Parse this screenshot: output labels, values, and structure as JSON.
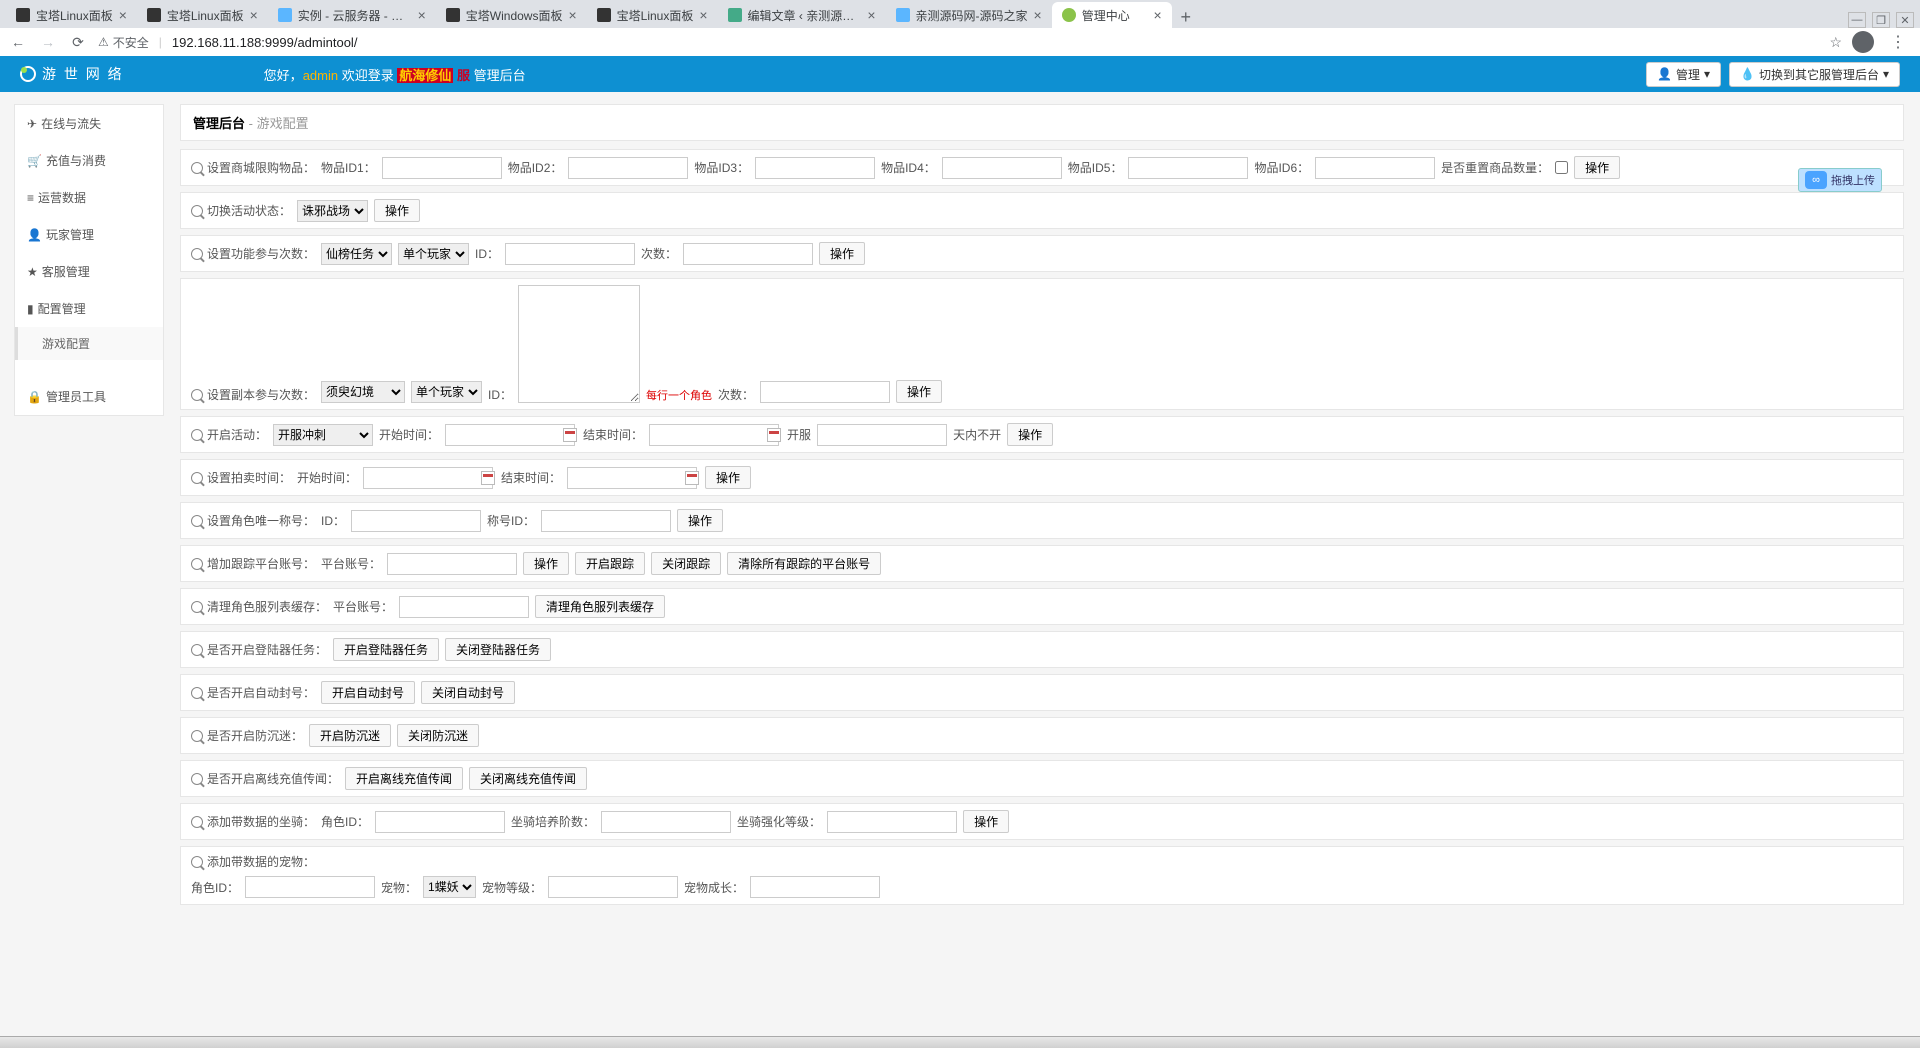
{
  "browser": {
    "tabs": [
      {
        "title": "宝塔Linux面板",
        "fav": "#333"
      },
      {
        "title": "宝塔Linux面板",
        "fav": "#333"
      },
      {
        "title": "实例 - 云服务器 - 控制台",
        "fav": "#5bb6ff"
      },
      {
        "title": "宝塔Windows面板",
        "fav": "#333"
      },
      {
        "title": "宝塔Linux面板",
        "fav": "#333"
      },
      {
        "title": "编辑文章 ‹ 亲测源码网 — W…",
        "fav": "#4a8"
      },
      {
        "title": "亲测源码网-源码之家",
        "fav": "#5bb6ff"
      },
      {
        "title": "管理中心",
        "fav": "#8bc34a"
      }
    ],
    "insecure": "不安全",
    "url": "192.168.11.188:9999/admintool/"
  },
  "top": {
    "brand": "游 世 网 络",
    "hello": "您好，",
    "admin": "admin",
    "welcome": " 欢迎登录 ",
    "srv1": "航海修仙",
    "srv2": "服",
    "suffix": " 管理后台",
    "btn_manage": "管理",
    "btn_switch": "切换到其它服管理后台"
  },
  "sidebar": {
    "items": [
      "在线与流失",
      "充值与消费",
      "运营数据",
      "玩家管理",
      "客服管理",
      "配置管理"
    ],
    "sub": "游戏配置",
    "last": "管理员工具"
  },
  "header": {
    "title": "管理后台",
    "sub": " - 游戏配置"
  },
  "ops": {
    "action": "操作",
    "shop": {
      "label": "设置商城限购物品：",
      "id1": "物品ID1：",
      "id2": "物品ID2：",
      "id3": "物品ID3：",
      "id4": "物品ID4：",
      "id5": "物品ID5：",
      "id6": "物品ID6：",
      "reset": "是否重置商品数量："
    },
    "activity": {
      "label": "切换活动状态：",
      "opt": "诛邪战场"
    },
    "func": {
      "label": "设置功能参与次数：",
      "o1": "仙榜任务",
      "o2": "单个玩家",
      "id": "ID：",
      "cnt": "次数："
    },
    "copy": {
      "label": "设置副本参与次数：",
      "o1": "须臾幻境",
      "o2": "单个玩家",
      "id": "ID：",
      "note": "每行一个角色",
      "cnt": "次数："
    },
    "start": {
      "label": "开启活动：",
      "opt": "开服冲刺",
      "st": "开始时间：",
      "et": "结束时间：",
      "ks": "开服",
      "dn": "天内不开"
    },
    "auction": {
      "label": "设置拍卖时间：",
      "st": "开始时间：",
      "et": "结束时间："
    },
    "unique": {
      "label": "设置角色唯一称号：",
      "id": "ID：",
      "title": "称号ID："
    },
    "track": {
      "label": "增加跟踪平台账号：",
      "acc": "平台账号：",
      "b1": "操作",
      "b2": "开启跟踪",
      "b3": "关闭跟踪",
      "b4": "清除所有跟踪的平台账号"
    },
    "cache": {
      "label": "清理角色服列表缓存：",
      "acc": "平台账号：",
      "b": "清理角色服列表缓存"
    },
    "logintask": {
      "label": "是否开启登陆器任务：",
      "b1": "开启登陆器任务",
      "b2": "关闭登陆器任务"
    },
    "autoban": {
      "label": "是否开启自动封号：",
      "b1": "开启自动封号",
      "b2": "关闭自动封号"
    },
    "anti": {
      "label": "是否开启防沉迷：",
      "b1": "开启防沉迷",
      "b2": "关闭防沉迷"
    },
    "offline": {
      "label": "是否开启离线充值传闻：",
      "b1": "开启离线充值传闻",
      "b2": "关闭离线充值传闻"
    },
    "mount": {
      "label": "添加带数据的坐骑：",
      "role": "角色ID：",
      "lv": "坐骑培养阶数：",
      "str": "坐骑强化等级："
    },
    "pet": {
      "label": "添加带数据的宠物：",
      "role": "角色ID：",
      "pet": "宠物：",
      "opt": "1蝶妖",
      "lv": "宠物等级：",
      "grow": "宠物成长："
    }
  },
  "upload": "拖拽上传"
}
